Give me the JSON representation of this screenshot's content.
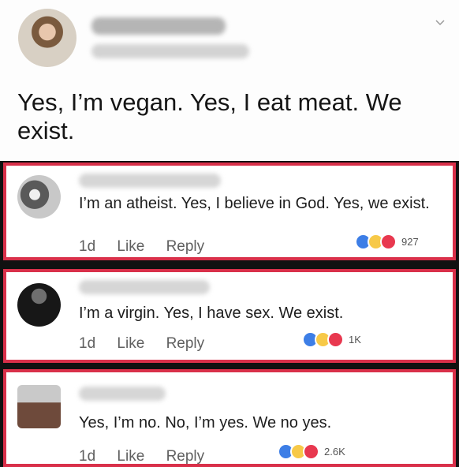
{
  "post": {
    "text": "Yes, I’m vegan. Yes, I eat meat. We exist."
  },
  "comments": [
    {
      "text": "I’m an atheist. Yes, I believe in God. Yes, we exist.",
      "time": "1d",
      "like_label": "Like",
      "reply_label": "Reply",
      "reaction_count": "927"
    },
    {
      "text": "I’m a virgin. Yes, I have sex. We exist.",
      "time": "1d",
      "like_label": "Like",
      "reply_label": "Reply",
      "reaction_count": "1K"
    },
    {
      "text": "Yes, I’m no. No, I’m yes. We no yes.",
      "time": "1d",
      "like_label": "Like",
      "reply_label": "Reply",
      "reaction_count": "2.6K"
    }
  ],
  "colors": {
    "highlight_border": "#d9304a",
    "like": "#3d7ee6",
    "haha": "#f7c948",
    "love": "#e8384f"
  },
  "icons": [
    "chevron-down-icon",
    "like-reaction-icon",
    "haha-reaction-icon",
    "love-reaction-icon"
  ]
}
